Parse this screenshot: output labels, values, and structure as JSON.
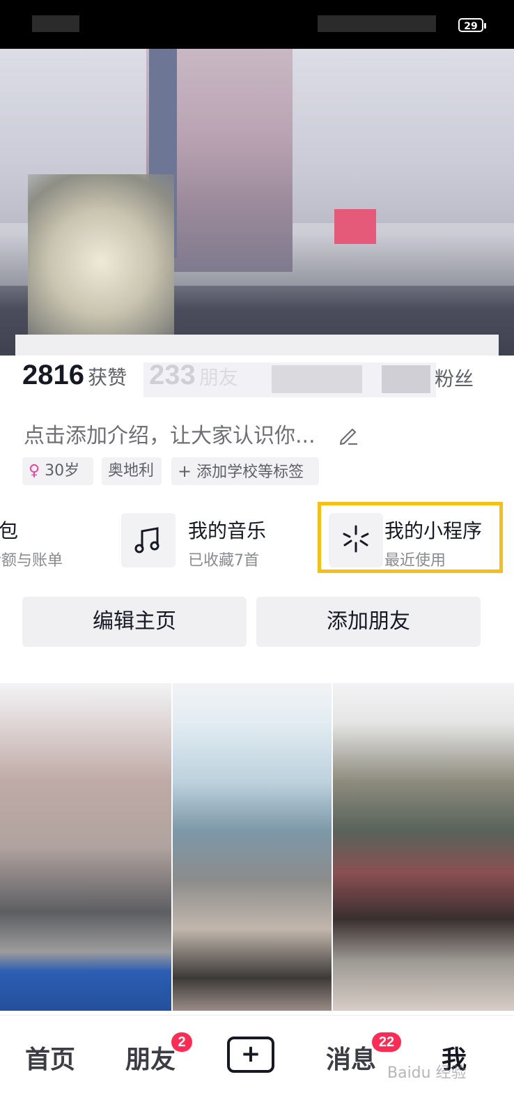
{
  "status_bar": {
    "battery": "29"
  },
  "stats": {
    "likes_count": "2816",
    "likes_label": "获赞",
    "friends_count": "233",
    "friends_label": "朋友",
    "fans_label": "粉丝"
  },
  "profile": {
    "intro_placeholder": "点击添加介绍，让大家认识你...",
    "tags": {
      "age": "30岁",
      "location": "奥地利",
      "add_school": "添加学校等标签"
    }
  },
  "entries": {
    "wallet": {
      "title": "钱包",
      "sub": "余额与账单"
    },
    "music": {
      "title": "我的音乐",
      "sub": "已收藏7首"
    },
    "mini_programs": {
      "title": "我的小程序",
      "sub": "最近使用"
    }
  },
  "buttons": {
    "edit_profile": "编辑主页",
    "add_friends": "添加朋友"
  },
  "bottom_nav": {
    "home": "首页",
    "friends": "朋友",
    "friends_badge": "2",
    "create": "+",
    "messages": "消息",
    "messages_badge": "22",
    "me": "我"
  },
  "watermark": "Baidu 经验"
}
